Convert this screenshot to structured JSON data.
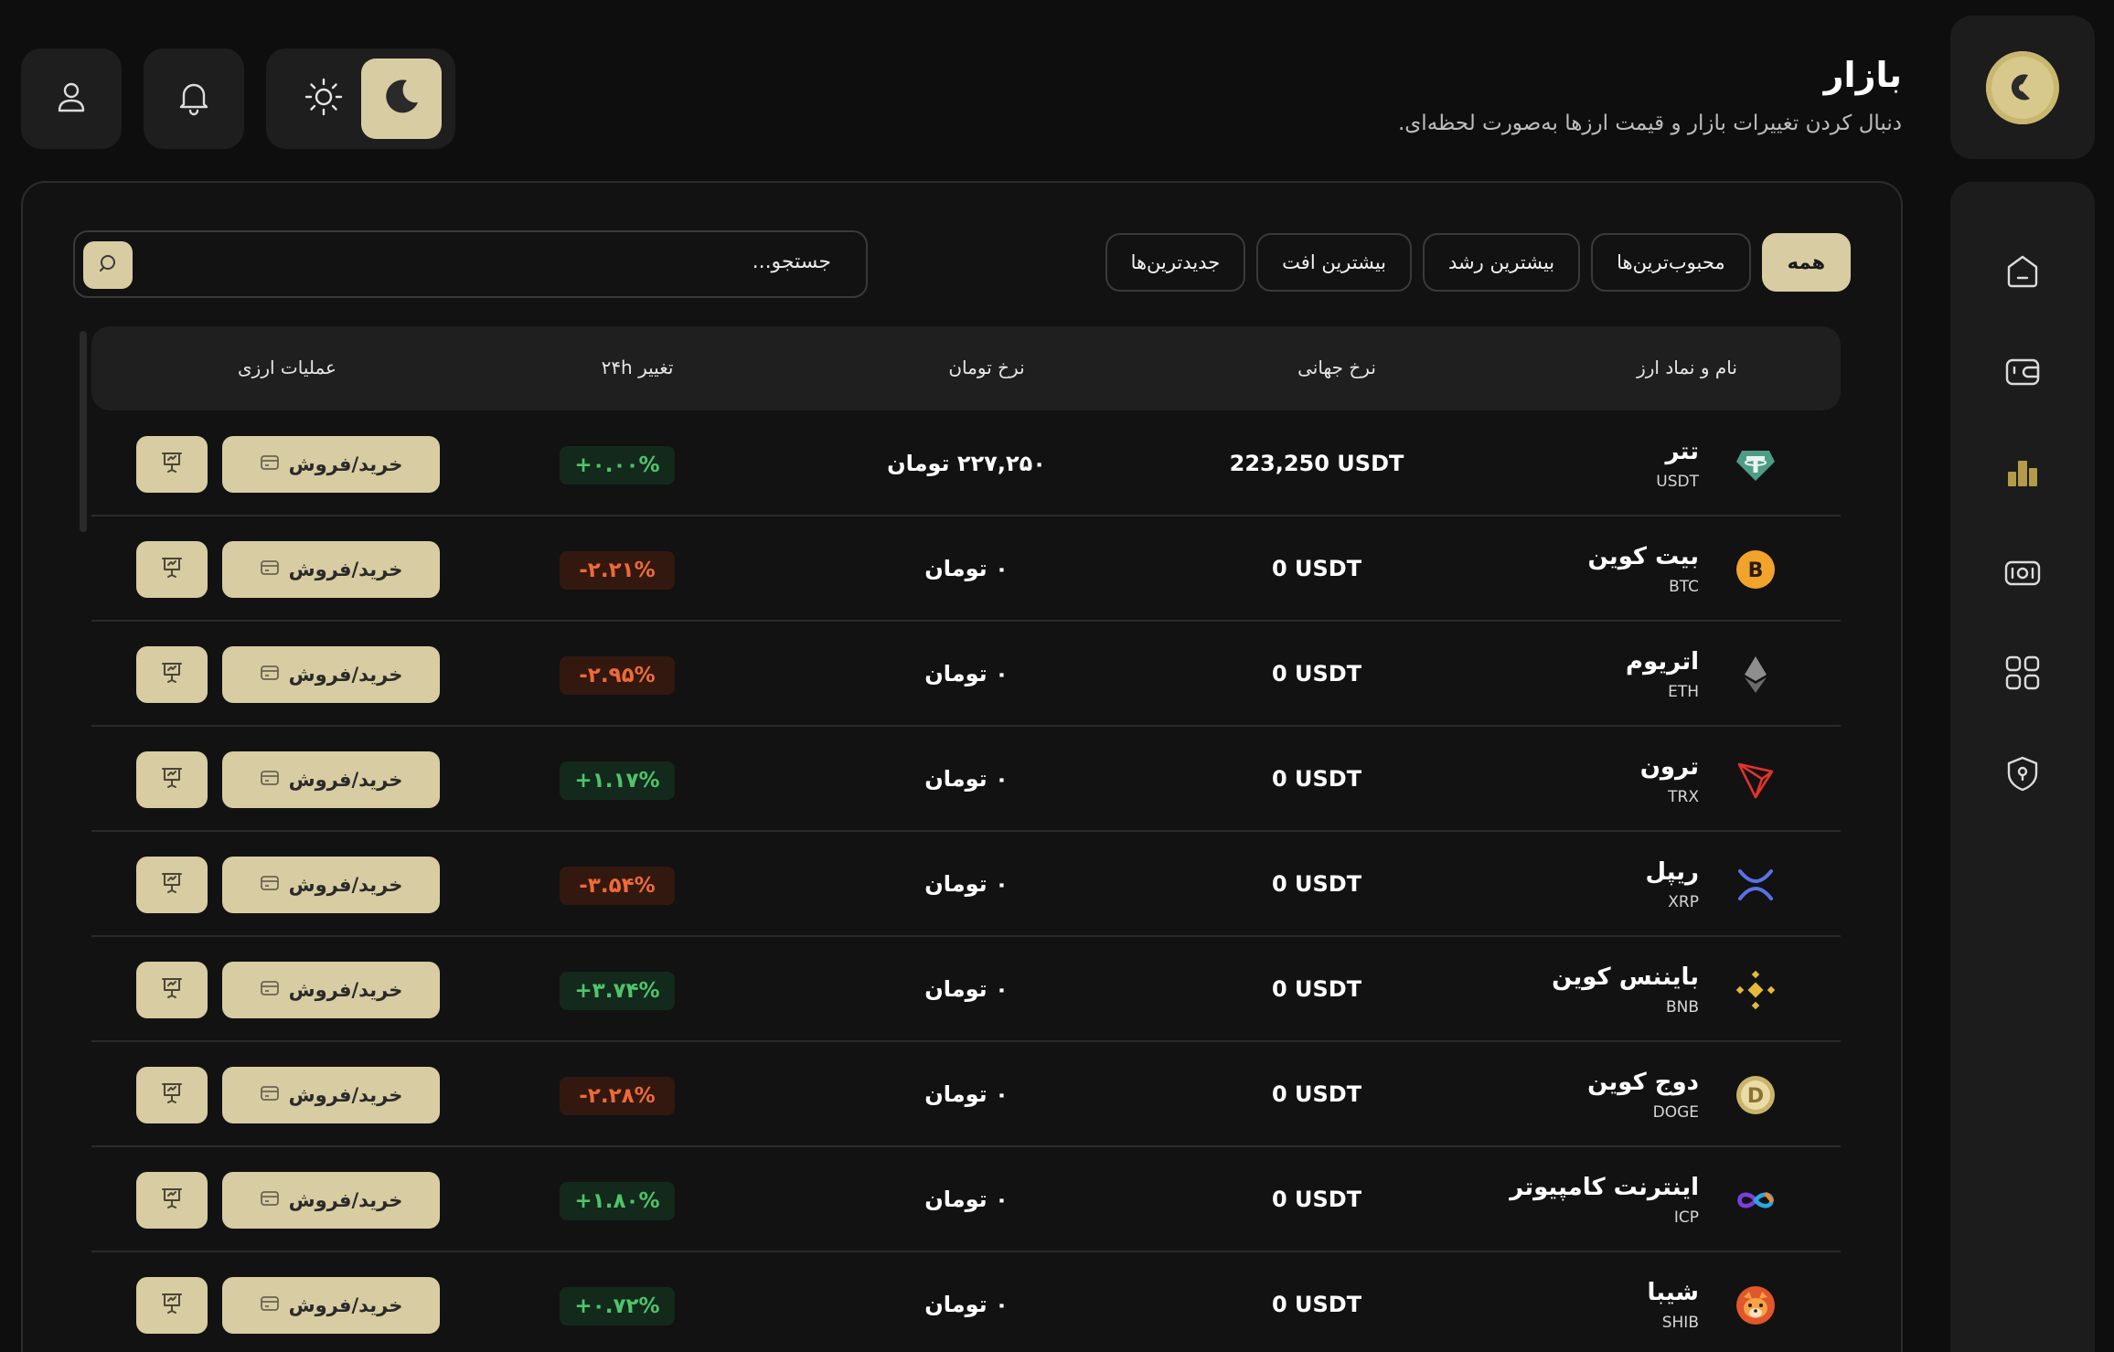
{
  "header": {
    "title": "بازار",
    "subtitle": "دنبال کردن تغییرات بازار و قیمت ارزها به‌صورت لحظه‌ای."
  },
  "topbar": {
    "profile_icon": "user-icon",
    "notification_icon": "bell-icon",
    "light_icon": "sun-icon",
    "dark_icon": "moon-icon"
  },
  "sidebar": {
    "logo_icon": "brand-logo",
    "items": [
      {
        "name": "home",
        "icon": "home-icon"
      },
      {
        "name": "wallet",
        "icon": "wallet-icon"
      },
      {
        "name": "market",
        "icon": "chart-icon"
      },
      {
        "name": "cash",
        "icon": "money-icon"
      },
      {
        "name": "apps",
        "icon": "grid-icon"
      },
      {
        "name": "security",
        "icon": "shield-icon"
      }
    ]
  },
  "filters": [
    {
      "label": "همه",
      "active": true
    },
    {
      "label": "محبوب‌ترین‌ها",
      "active": false
    },
    {
      "label": "بیشترین رشد",
      "active": false
    },
    {
      "label": "بیشترین افت",
      "active": false
    },
    {
      "label": "جدیدترین‌ها",
      "active": false
    }
  ],
  "search": {
    "placeholder": "جستجو..."
  },
  "table": {
    "columns": {
      "name": "نام و نماد ارز",
      "global": "نرخ جهانی",
      "toman": "نرخ تومان",
      "change": "تغییر ۲۴h",
      "actions": "عملیات ارزی"
    },
    "trade_label": "خرید/فروش",
    "rows": [
      {
        "name": "تتر",
        "symbol": "USDT",
        "global": "223,250 USDT",
        "toman": "۲۲۷,۲۵۰ تومان",
        "change": "+۰.۰۰%",
        "dir": "up"
      },
      {
        "name": "بیت کوین",
        "symbol": "BTC",
        "global": "0 USDT",
        "toman": "۰ تومان",
        "change": "-۲.۲۱%",
        "dir": "down"
      },
      {
        "name": "اتریوم",
        "symbol": "ETH",
        "global": "0 USDT",
        "toman": "۰ تومان",
        "change": "-۲.۹۵%",
        "dir": "down"
      },
      {
        "name": "ترون",
        "symbol": "TRX",
        "global": "0 USDT",
        "toman": "۰ تومان",
        "change": "+۱.۱۷%",
        "dir": "up"
      },
      {
        "name": "ریپل",
        "symbol": "XRP",
        "global": "0 USDT",
        "toman": "۰ تومان",
        "change": "-۳.۵۴%",
        "dir": "down"
      },
      {
        "name": "بایننس کوین",
        "symbol": "BNB",
        "global": "0 USDT",
        "toman": "۰ تومان",
        "change": "+۳.۷۴%",
        "dir": "up"
      },
      {
        "name": "دوج کوین",
        "symbol": "DOGE",
        "global": "0 USDT",
        "toman": "۰ تومان",
        "change": "-۲.۲۸%",
        "dir": "down"
      },
      {
        "name": "اینترنت کامپیوتر",
        "symbol": "ICP",
        "global": "0 USDT",
        "toman": "۰ تومان",
        "change": "+۱.۸۰%",
        "dir": "up"
      },
      {
        "name": "شیبا",
        "symbol": "SHIB",
        "global": "0 USDT",
        "toman": "۰ تومان",
        "change": "+۰.۷۲%",
        "dir": "up"
      }
    ]
  },
  "colors": {
    "accent": "#d8cca2",
    "positive": "#4ec46b",
    "negative": "#ee6a38",
    "background": "#0e0e0e"
  }
}
